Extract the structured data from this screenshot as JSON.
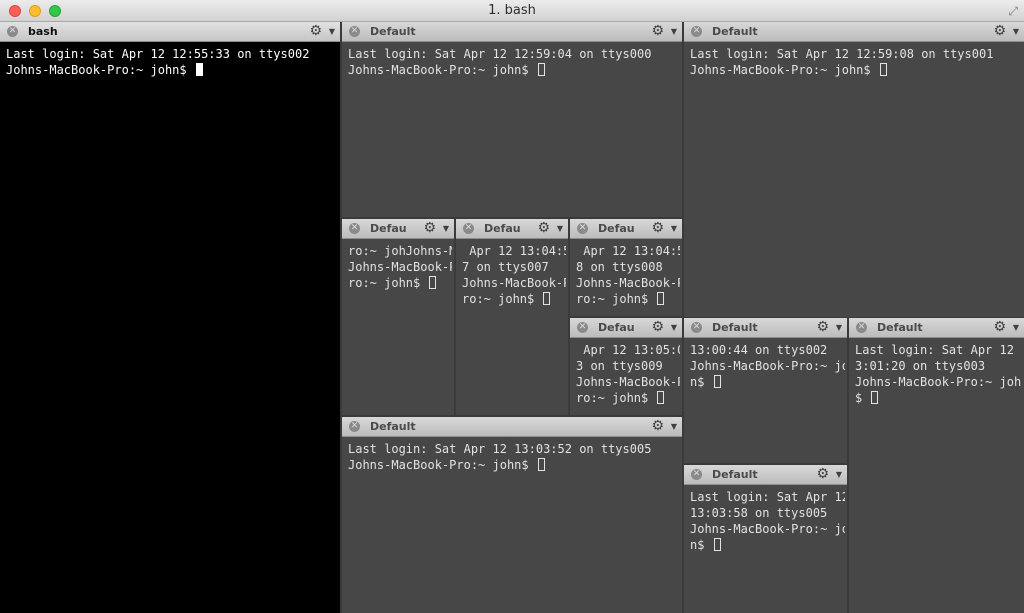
{
  "window": {
    "title": "1. bash",
    "fullscreen_icon": "expand-arrows-icon"
  },
  "panes": [
    {
      "id": "bash",
      "title": "bash",
      "lines": [
        "Last login: Sat Apr 12 12:55:33 on ttys002",
        "Johns-MacBook-Pro:~ john$ "
      ]
    },
    {
      "id": "top-mid",
      "title": "Default",
      "lines": [
        "Last login: Sat Apr 12 12:59:04 on ttys000",
        "Johns-MacBook-Pro:~ john$ "
      ]
    },
    {
      "id": "top-right",
      "title": "Default",
      "lines": [
        "Last login: Sat Apr 12 12:59:08 on ttys001",
        "Johns-MacBook-Pro:~ john$ "
      ]
    },
    {
      "id": "small-1",
      "title": "Defau",
      "lines": [
        "ro:~ johJohns-M",
        "Johns-MacBook-P",
        "ro:~ john$ "
      ]
    },
    {
      "id": "small-2",
      "title": "Defau",
      "lines": [
        " Apr 12 13:04:5",
        "7 on ttys007",
        "Johns-MacBook-P",
        "ro:~ john$ "
      ]
    },
    {
      "id": "small-3",
      "title": "Defau",
      "lines": [
        " Apr 12 13:04:5",
        "8 on ttys008",
        "Johns-MacBook-P",
        "ro:~ john$ "
      ]
    },
    {
      "id": "small-4",
      "title": "Defau",
      "lines": [
        " Apr 12 13:05:0",
        "3 on ttys009",
        "Johns-MacBook-P",
        "ro:~ john$ "
      ]
    },
    {
      "id": "mid-right-a",
      "title": "Default",
      "lines": [
        "13:00:44 on ttys002",
        "Johns-MacBook-Pro:~ joh",
        "n$ "
      ]
    },
    {
      "id": "mid-right-b",
      "title": "Default",
      "lines": [
        "Last login: Sat Apr 12 1",
        "3:01:20 on ttys003",
        "Johns-MacBook-Pro:~ john",
        "$ "
      ]
    },
    {
      "id": "bottom-mid",
      "title": "Default",
      "lines": [
        "Last login: Sat Apr 12 13:03:52 on ttys005",
        "Johns-MacBook-Pro:~ john$ "
      ]
    },
    {
      "id": "bottom-right",
      "title": "Default",
      "lines": [
        "Last login: Sat Apr 12",
        "13:03:58 on ttys005",
        "Johns-MacBook-Pro:~ joh",
        "n$ "
      ]
    }
  ],
  "icons": {
    "close": "close-pane-icon",
    "settings": "gear-icon",
    "menu": "dropdown-triangle-icon"
  }
}
